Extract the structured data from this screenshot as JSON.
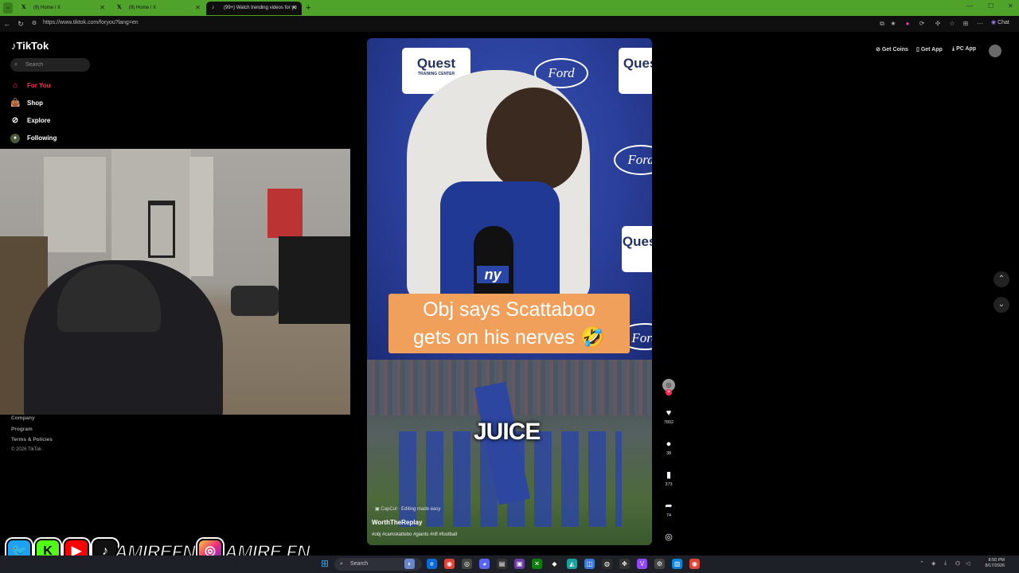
{
  "browser": {
    "tabs": [
      {
        "title": "(9) Home / X",
        "icon": "x-logo-icon"
      },
      {
        "title": "(9) Home / X",
        "icon": "x-logo-icon"
      },
      {
        "title": "(99+) Watch trending videos for yo",
        "icon": "tiktok-logo-icon"
      }
    ],
    "url": "https://www.tiktok.com/foryou?lang=en",
    "chat_label": "Chat"
  },
  "tiktok": {
    "logo_text": "TikTok",
    "search_placeholder": "Search",
    "nav": [
      {
        "label": "For You",
        "icon": "home-icon",
        "active": true
      },
      {
        "label": "Shop",
        "icon": "shop-bag-icon",
        "active": false
      },
      {
        "label": "Explore",
        "icon": "compass-icon",
        "active": false
      },
      {
        "label": "Following",
        "icon": "following-avatar-icon",
        "active": false
      }
    ],
    "footer": [
      "Company",
      "Program",
      "Terms & Policies",
      "© 2026 TikTok"
    ],
    "top_right": {
      "get_coins": "Get Coins",
      "get_app": "Get App",
      "pc_app": "PC App"
    },
    "video": {
      "caption_line1": "Obj says Scattaboo",
      "caption_line2": "gets on his nerves 🤣",
      "overlay_text": "JUICE",
      "sign_brand": "Quest",
      "sign_sub": "TRAINING CENTER",
      "ford": "Ford",
      "capcut": "CapCut · Editing made easy",
      "creator": "WorthTheReplay",
      "hashtags": "#obj #camskattebo #giants #nfl #football"
    },
    "actions": {
      "likes": "7802",
      "comments": "38",
      "saves": "373",
      "shares": "74"
    }
  },
  "stream_overlay": {
    "handle1": "AMIREFN",
    "handle2": "AMIRE.FN"
  },
  "taskbar": {
    "search_label": "Search",
    "time": "8:50 PM",
    "date": "8/17/2026"
  },
  "colors": {
    "tiktok_red": "#fe2c55",
    "tab_green": "#4fa22a",
    "caption_orange": "#f0a05a"
  }
}
